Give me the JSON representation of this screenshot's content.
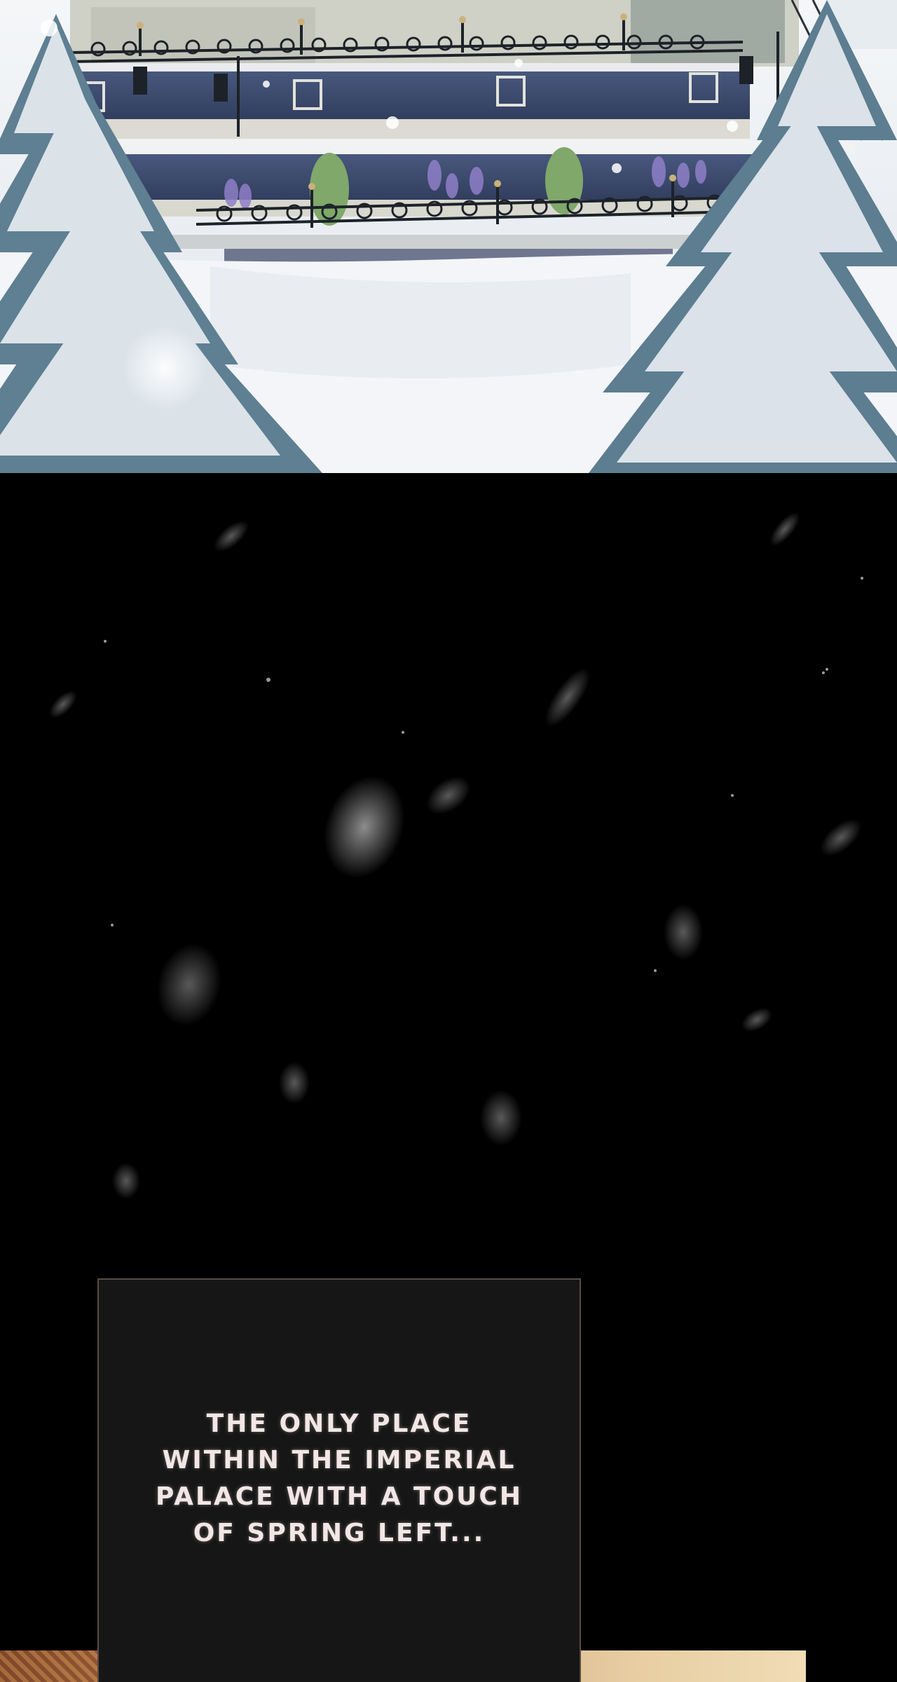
{
  "scene": {
    "top_panel": {
      "description_icon": "snowy-palace-garden-illustration",
      "colors": {
        "snow": "#eef2f6",
        "wall": "#3c4a6e",
        "stone": "#d8d6cc",
        "railing": "#1c2228",
        "pine": "#5f7f92",
        "lavender": "#8f7fc8",
        "topiary": "#7fa86a"
      }
    },
    "dark_panel": {
      "background": "#000000",
      "snowflake_color": "#ffffff"
    }
  },
  "narration": {
    "lines": [
      "The only place",
      "within the imperial",
      "palace with a touch",
      "of spring left..."
    ]
  },
  "next_panel": {
    "icon": "ornate-carpet-illustration"
  }
}
